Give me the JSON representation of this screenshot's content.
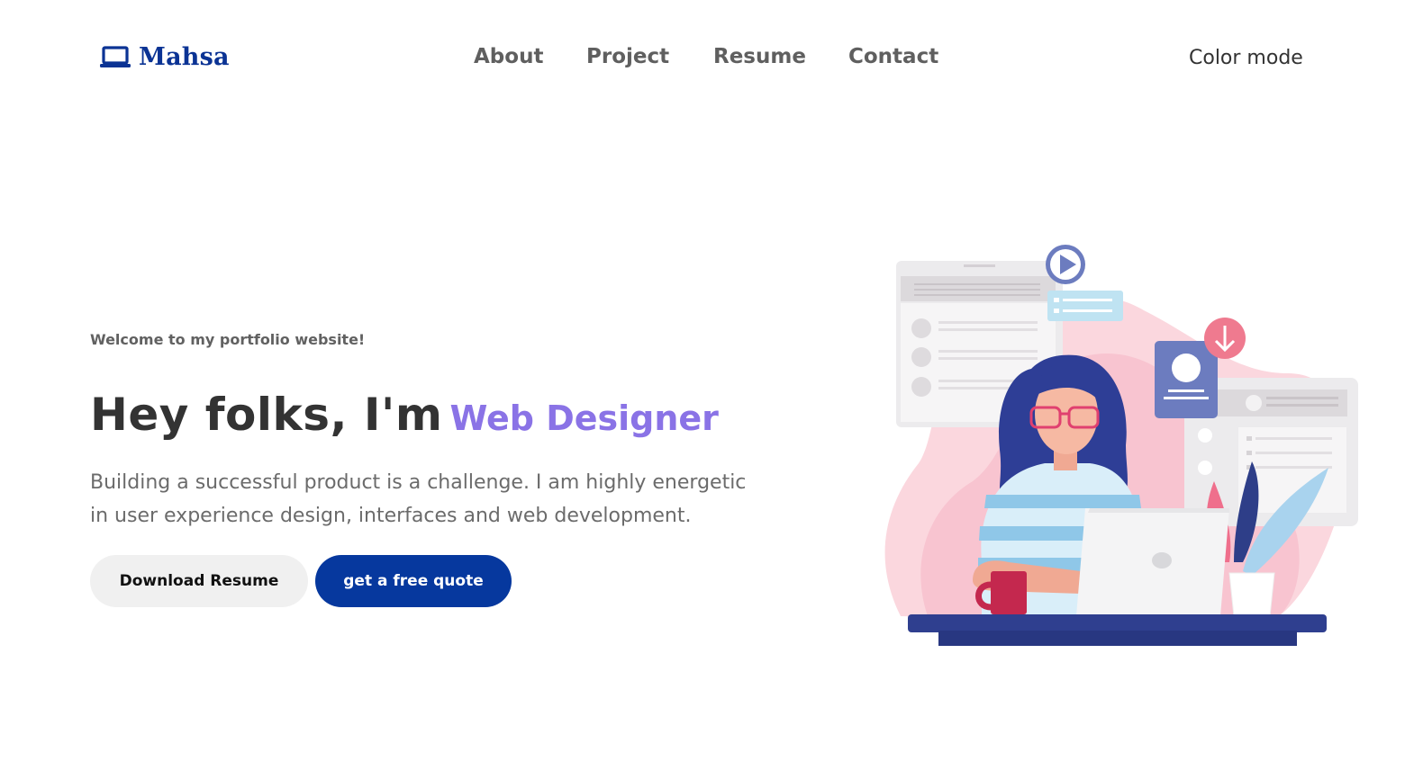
{
  "header": {
    "logo_text": "Mahsa",
    "logo_icon": "laptop-icon",
    "nav": [
      {
        "label": "About"
      },
      {
        "label": "Project"
      },
      {
        "label": "Resume"
      },
      {
        "label": "Contact"
      }
    ],
    "color_mode_label": "Color mode"
  },
  "hero": {
    "welcome": "Welcome to my portfolio website!",
    "headline": "Hey folks, I'm",
    "role": "Web Designer",
    "subtitle_line1": "Building a successful product is a challenge. I am highly energetic",
    "subtitle_line2": "in user experience design, interfaces and web development.",
    "buttons": {
      "download": "Download Resume",
      "quote": "get a free quote"
    }
  },
  "colors": {
    "brand": "#0b3394",
    "accent": "#8a73e6",
    "primary_button": "#06389e",
    "secondary_button": "#f0f0f0"
  }
}
